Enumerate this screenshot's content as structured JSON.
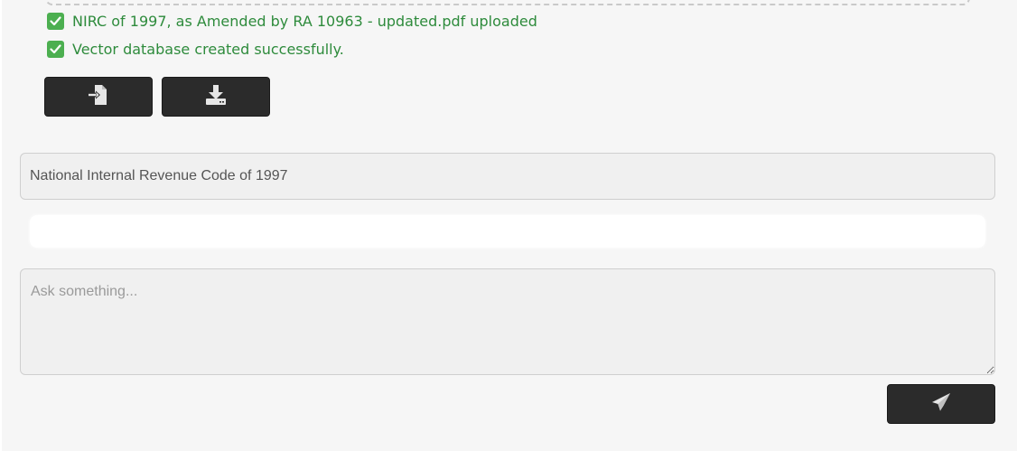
{
  "upload_status": {
    "file_uploaded_message": "NIRC of 1997, as Amended by RA 10963 - updated.pdf uploaded",
    "vector_db_message": "Vector database created successfully."
  },
  "actions": {
    "import_icon": "file-import-icon",
    "download_icon": "download-icon"
  },
  "document": {
    "title_value": "National Internal Revenue Code of 1997"
  },
  "answer": {
    "text": ""
  },
  "question": {
    "placeholder": "Ask something...",
    "value": ""
  },
  "send": {
    "icon": "paper-plane-icon"
  },
  "colors": {
    "success_text": "#2e8b3c",
    "success_check": "#4caf50",
    "button_bg": "#2b2b2b",
    "input_bg": "#f0f0f0",
    "page_bg": "#f6f6f6"
  }
}
